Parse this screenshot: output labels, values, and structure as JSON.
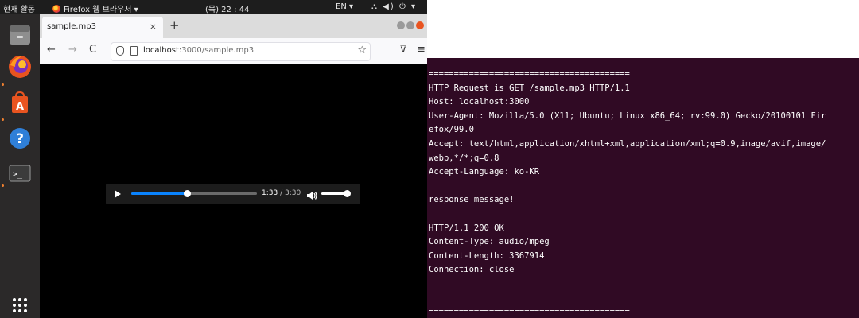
{
  "topbar": {
    "activities": "현재 활동",
    "app_menu": "Firefox 웹 브라우저 ▾",
    "clock": "(목) 22 : 44",
    "language": "EN ▾",
    "system": "⛬ ◀) ⏻ ▾"
  },
  "dock": {
    "items": [
      "files-icon",
      "firefox-icon",
      "software-icon",
      "help-icon",
      "terminal-icon",
      "show-apps-icon"
    ]
  },
  "browser": {
    "tab_title": "sample.mp3",
    "tab_close": "×",
    "new_tab": "+",
    "nav_back": "←",
    "nav_forward": "→",
    "nav_reload": "C",
    "url_host": "localhost",
    "url_path": ":3000/sample.mp3",
    "bookmark_star": "☆",
    "pocket": "⊽",
    "menu": "≡"
  },
  "player": {
    "current_time": "1:33",
    "separator": " / ",
    "duration": "3:30",
    "progress_fraction": 0.44,
    "volume_fraction": 0.9
  },
  "terminal": {
    "lines": [
      "========================================",
      "HTTP Request is GET /sample.mp3 HTTP/1.1",
      "Host: localhost:3000",
      "User-Agent: Mozilla/5.0 (X11; Ubuntu; Linux x86_64; rv:99.0) Gecko/20100101 Fir",
      "efox/99.0",
      "Accept: text/html,application/xhtml+xml,application/xml;q=0.9,image/avif,image/",
      "webp,*/*;q=0.8",
      "Accept-Language: ko-KR",
      "",
      "response message!",
      "",
      "HTTP/1.1 200 OK",
      "Content-Type: audio/mpeg",
      "Content-Length: 3367914",
      "Connection: close",
      "",
      "",
      "========================================"
    ]
  },
  "colors": {
    "terminal_bg": "#300a24",
    "progress_accent": "#0a84ff",
    "ubuntu_orange": "#e95420"
  }
}
